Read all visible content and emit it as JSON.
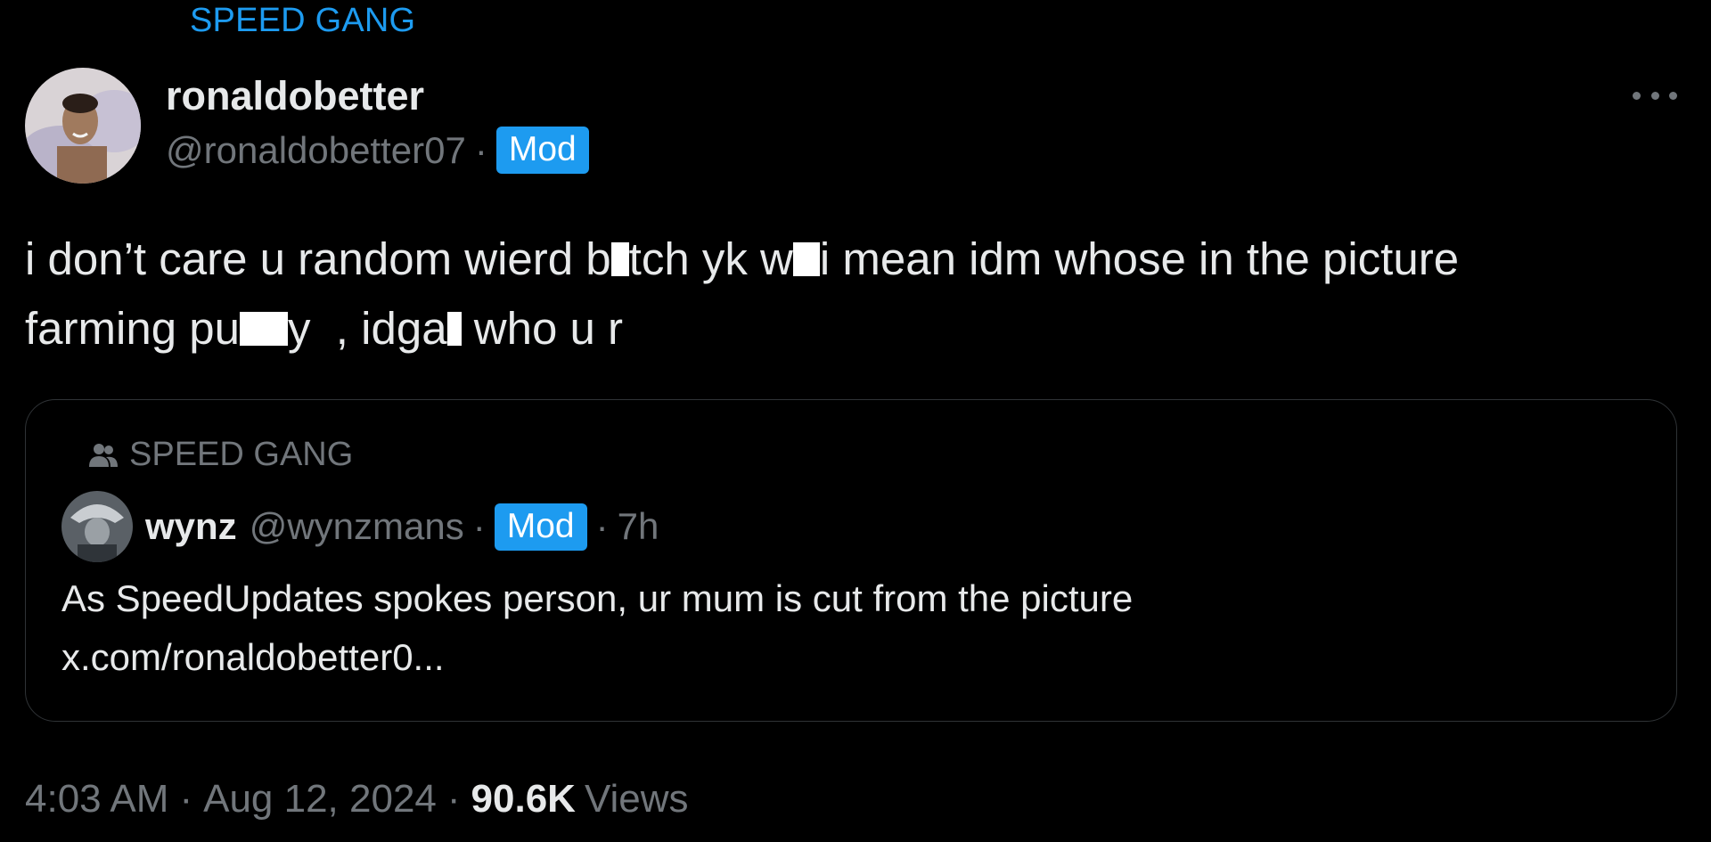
{
  "community": {
    "name": "SPEED GANG"
  },
  "tweet": {
    "display_name": "ronaldobetter",
    "handle": "@ronaldobetter07",
    "separator": "·",
    "badge": "Mod",
    "text_parts": {
      "p1": "i don’t care u random wierd b",
      "p2": "tch yk w",
      "p3": "i mean idm whose in the picture",
      "p4": "farming pu",
      "p5": "y  , idga",
      "p6": " who u r"
    },
    "more_label": "More"
  },
  "quote": {
    "community": "SPEED GANG",
    "display_name": "wynz",
    "handle": "@wynzmans",
    "badge": "Mod",
    "time": "7h",
    "separator": "·",
    "text_line1": "As SpeedUpdates spokes person, ur mum is cut from the picture",
    "text_line2": "x.com/ronaldobetter0..."
  },
  "meta": {
    "time": "4:03 AM",
    "date": "Aug 12, 2024",
    "views_count": "90.6K",
    "views_label": "Views",
    "separator": "·"
  },
  "colors": {
    "background": "#000000",
    "accent": "#1d9bf0",
    "text_primary": "#e7e9ea",
    "text_secondary": "#71767b",
    "border": "#2f3336"
  }
}
